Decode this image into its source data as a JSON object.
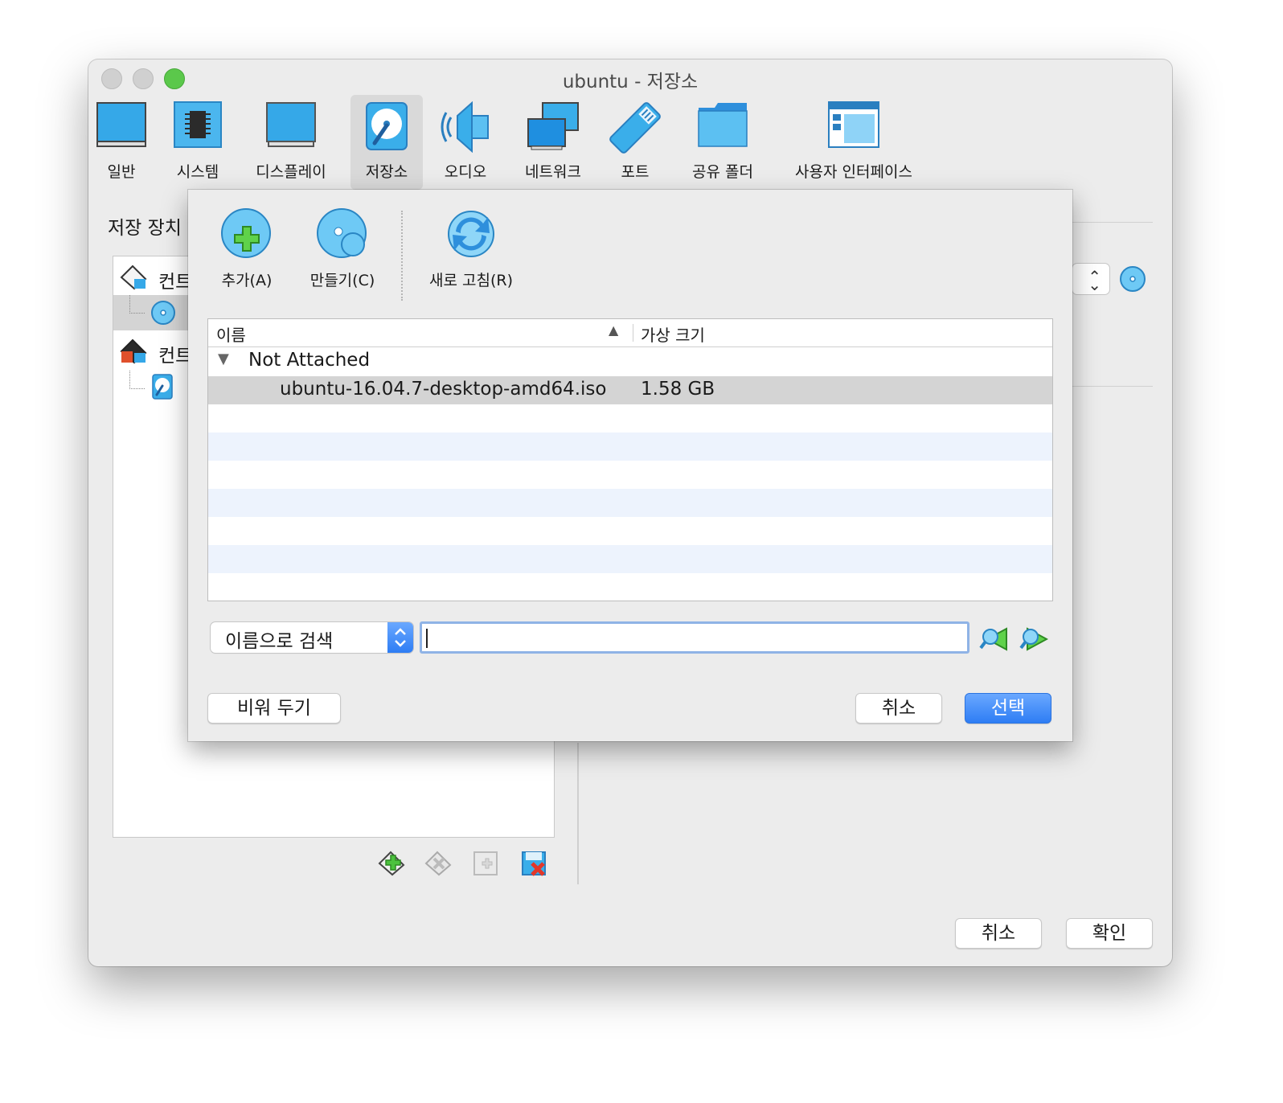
{
  "window": {
    "title": "ubuntu - 저장소"
  },
  "toolbar": {
    "items": [
      {
        "label": "일반",
        "icon": "monitor-icon"
      },
      {
        "label": "시스템",
        "icon": "chip-icon"
      },
      {
        "label": "디스플레이",
        "icon": "display-icon"
      },
      {
        "label": "저장소",
        "icon": "harddisk-icon",
        "selected": true
      },
      {
        "label": "오디오",
        "icon": "speaker-icon"
      },
      {
        "label": "네트워크",
        "icon": "network-icon"
      },
      {
        "label": "포트",
        "icon": "port-icon"
      },
      {
        "label": "공유 폴더",
        "icon": "folder-icon"
      },
      {
        "label": "사용자 인터페이스",
        "icon": "ui-window-icon"
      }
    ]
  },
  "storage": {
    "heading": "저장 장치",
    "tree": [
      {
        "label": "컨트롤러",
        "icon": "ide-controller-icon"
      },
      {
        "label": "",
        "icon": "optical-disc-icon",
        "selected": true
      },
      {
        "label": "컨트롤러",
        "icon": "sata-controller-icon"
      },
      {
        "label": "",
        "icon": "harddisk-small-icon"
      }
    ]
  },
  "dialog": {
    "toolbar": [
      {
        "label": "추가(A)",
        "icon": "add-disc-icon"
      },
      {
        "label": "만들기(C)",
        "icon": "create-disc-icon"
      },
      {
        "label": "새로 고침(R)",
        "icon": "refresh-icon"
      }
    ],
    "list": {
      "columns": [
        "이름",
        "가상 크기"
      ],
      "group": "Not Attached",
      "rows": [
        {
          "name": "ubuntu-16.04.7-desktop-amd64.iso",
          "size": "1.58 GB"
        }
      ]
    },
    "search": {
      "mode": "이름으로 검색",
      "value": ""
    },
    "buttons": {
      "leave_empty": "비워 두기",
      "cancel": "취소",
      "choose": "선택"
    }
  },
  "footer": {
    "cancel": "취소",
    "ok": "확인"
  },
  "colors": {
    "accent": "#2e7df4",
    "icon_blue": "#35a8e8",
    "stripe": "#edf3fd",
    "selection": "#d4d4d4"
  }
}
